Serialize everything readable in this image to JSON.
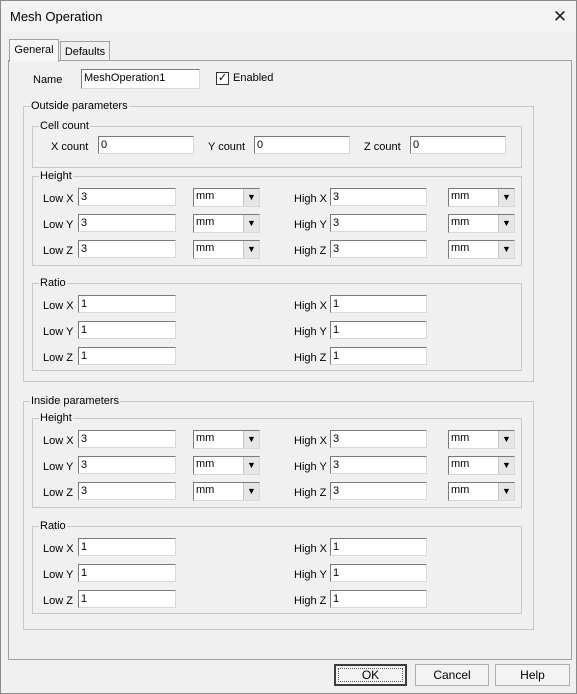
{
  "window": {
    "title": "Mesh Operation",
    "close_glyph": "✕"
  },
  "tabs": [
    {
      "label": "General"
    },
    {
      "label": "Defaults"
    }
  ],
  "general": {
    "name_label": "Name",
    "name_value": "MeshOperation1",
    "enabled_label": "Enabled",
    "enabled_checked": true,
    "check_glyph": "✓"
  },
  "outside": {
    "title": "Outside parameters",
    "cell_count": {
      "title": "Cell count",
      "x_label": "X count",
      "x_value": "0",
      "y_label": "Y count",
      "y_value": "0",
      "z_label": "Z count",
      "z_value": "0"
    },
    "height": {
      "title": "Height",
      "rows": [
        {
          "low_label": "Low X",
          "low_value": "3",
          "low_unit": "mm",
          "high_label": "High X",
          "high_value": "3",
          "high_unit": "mm"
        },
        {
          "low_label": "Low Y",
          "low_value": "3",
          "low_unit": "mm",
          "high_label": "High Y",
          "high_value": "3",
          "high_unit": "mm"
        },
        {
          "low_label": "Low Z",
          "low_value": "3",
          "low_unit": "mm",
          "high_label": "High Z",
          "high_value": "3",
          "high_unit": "mm"
        }
      ]
    },
    "ratio": {
      "title": "Ratio",
      "rows": [
        {
          "low_label": "Low X",
          "low_value": "1",
          "high_label": "High X",
          "high_value": "1"
        },
        {
          "low_label": "Low Y",
          "low_value": "1",
          "high_label": "High Y",
          "high_value": "1"
        },
        {
          "low_label": "Low Z",
          "low_value": "1",
          "high_label": "High Z",
          "high_value": "1"
        }
      ]
    }
  },
  "inside": {
    "title": "Inside parameters",
    "height": {
      "title": "Height",
      "rows": [
        {
          "low_label": "Low X",
          "low_value": "3",
          "low_unit": "mm",
          "high_label": "High X",
          "high_value": "3",
          "high_unit": "mm"
        },
        {
          "low_label": "Low Y",
          "low_value": "3",
          "low_unit": "mm",
          "high_label": "High Y",
          "high_value": "3",
          "high_unit": "mm"
        },
        {
          "low_label": "Low Z",
          "low_value": "3",
          "low_unit": "mm",
          "high_label": "High Z",
          "high_value": "3",
          "high_unit": "mm"
        }
      ]
    },
    "ratio": {
      "title": "Ratio",
      "rows": [
        {
          "low_label": "Low X",
          "low_value": "1",
          "high_label": "High X",
          "high_value": "1"
        },
        {
          "low_label": "Low Y",
          "low_value": "1",
          "high_label": "High Y",
          "high_value": "1"
        },
        {
          "low_label": "Low Z",
          "low_value": "1",
          "high_label": "High Z",
          "high_value": "1"
        }
      ]
    }
  },
  "buttons": {
    "ok": "OK",
    "cancel": "Cancel",
    "help": "Help"
  },
  "icons": {
    "dropdown_arrow": "▼"
  }
}
